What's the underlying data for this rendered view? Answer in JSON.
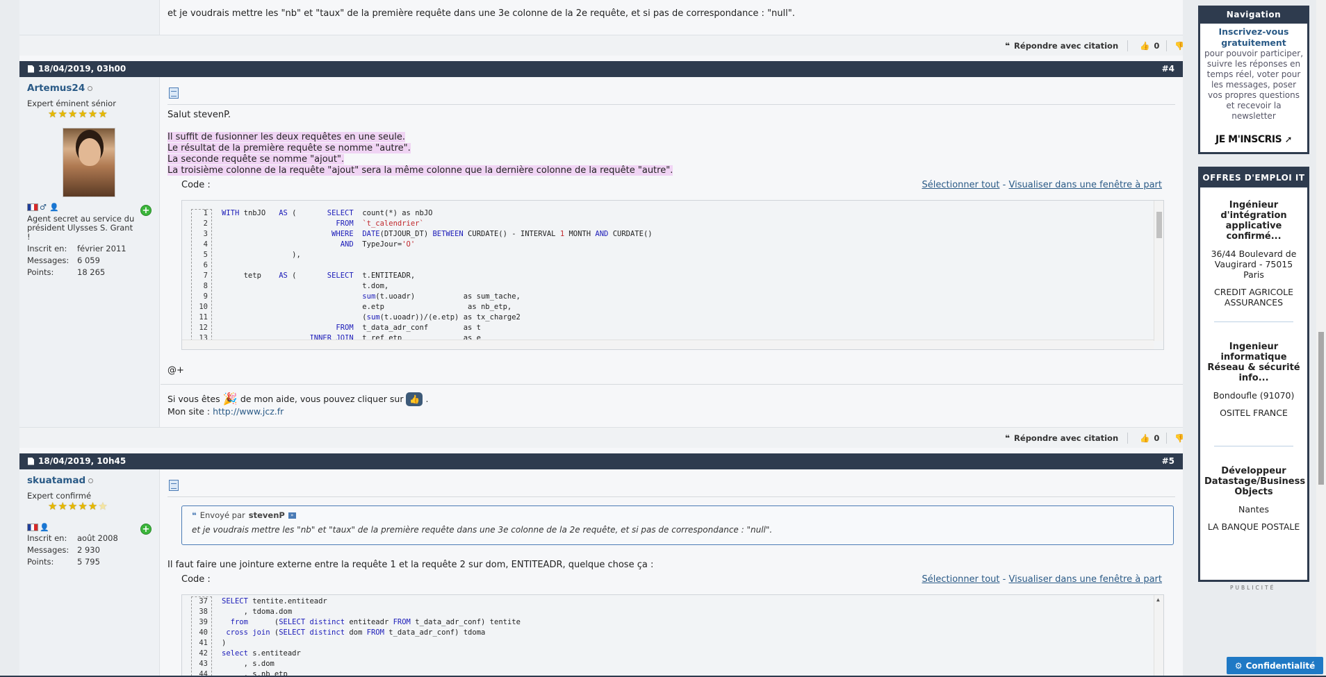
{
  "top_post": {
    "text": "et je voudrais mettre les \"nb\" et \"taux\" de la première requête dans une 3e colonne de la 2e requête, et si pas de correspondance : \"null\"."
  },
  "reply_bar": {
    "quote_label": "Répondre avec citation",
    "like_count": "0",
    "dislike_count": "0"
  },
  "post4": {
    "date": "18/04/2019, 03h00",
    "number": "#4",
    "user": {
      "name": "Artemus24",
      "rank": "Expert éminent sénior",
      "stars_on": "★★★★★★",
      "stars_off": "",
      "bio": "Agent secret au service du président Ulysses S. Grant !",
      "stats": [
        {
          "k": "Inscrit en:",
          "v": "février 2011"
        },
        {
          "k": "Messages:",
          "v": "6 059"
        },
        {
          "k": "Points:",
          "v": "18 265"
        }
      ]
    },
    "greeting": "Salut stevenP.",
    "lines": [
      "Il suffit de fusionner les deux requêtes en une seule.",
      "Le résultat de la première requête se nomme \"autre\".",
      "La seconde requête se nomme \"ajout\".",
      "La troisième colonne de la requête \"ajout\" sera la même colonne que la dernière colonne de la requête \"autre\"."
    ],
    "code_label": "Code :",
    "select_all": "Sélectionner tout",
    "dash": "-",
    "view_window": "Visualiser dans une fenêtre à part",
    "code": [
      {
        "n": "1",
        "html": "<span class=\"kw\">WITH</span> tnbJO   <span class=\"kw\">AS</span> (       <span class=\"kw\">SELECT</span>  count(*) as nbJO"
      },
      {
        "n": "2",
        "html": "                          <span class=\"kw\">FROM</span>  <span class=\"str\">`t_calendrier`</span>"
      },
      {
        "n": "3",
        "html": "                         <span class=\"kw\">WHERE</span>  <span class=\"kw\">DATE</span>(DTJOUR_DT) <span class=\"kw\">BETWEEN</span> CURDATE() - INTERVAL <span class=\"str\">1</span> MONTH <span class=\"kw\">AND</span> CURDATE()"
      },
      {
        "n": "4",
        "html": "                           <span class=\"kw\">AND</span>  TypeJour=<span class=\"str\">'O'</span>"
      },
      {
        "n": "5",
        "html": "                ),"
      },
      {
        "n": "6",
        "html": ""
      },
      {
        "n": "7",
        "html": "     tetp    <span class=\"kw\">AS</span> (       <span class=\"kw\">SELECT</span>  t.ENTITEADR,"
      },
      {
        "n": "8",
        "html": "                                t.dom,"
      },
      {
        "n": "9",
        "html": "                                <span class=\"kw\">sum</span>(t.uoadr)           as sum_tache,"
      },
      {
        "n": "10",
        "html": "                                e.etp                   as nb_etp,"
      },
      {
        "n": "11",
        "html": "                                (<span class=\"kw\">sum</span>(t.uoadr))/(e.etp) as tx_charge2"
      },
      {
        "n": "12",
        "html": "                          <span class=\"kw\">FROM</span>  t_data_adr_conf        as t"
      },
      {
        "n": "13",
        "html": "                    <span class=\"kw\">INNER JOIN</span>  t_ref_etp              as e"
      }
    ],
    "at_plus": "@+",
    "sig_pre": "Si vous êtes",
    "sig_mid": "de mon aide, vous pouvez cliquer sur",
    "sig_end": ".",
    "site_label": "Mon site :",
    "site_url": "http://www.jcz.fr"
  },
  "post5": {
    "date": "18/04/2019, 10h45",
    "number": "#5",
    "user": {
      "name": "skuatamad",
      "rank": "Expert confirmé",
      "stars_on": "★★★★★",
      "stars_off": "★",
      "stats": [
        {
          "k": "Inscrit en:",
          "v": "août 2008"
        },
        {
          "k": "Messages:",
          "v": "2 930"
        },
        {
          "k": "Points:",
          "v": "5 795"
        }
      ]
    },
    "quote_sent_by": "Envoyé par",
    "quote_author": "stevenP",
    "quote_text": "et je voudrais mettre les \"nb\" et \"taux\" de la première requête dans une 3e colonne de la 2e requête, et si pas de correspondance : \"null\".",
    "body": "Il faut faire une jointure externe entre la requête 1 et la requête 2 sur dom, ENTITEADR, quelque chose ça :",
    "code_label": "Code :",
    "select_all": "Sélectionner tout",
    "dash": "-",
    "view_window": "Visualiser dans une fenêtre à part",
    "code": [
      {
        "n": "37",
        "html": "<span class=\"kw\">SELECT</span> tentite.entiteadr"
      },
      {
        "n": "38",
        "html": "     , tdoma.dom"
      },
      {
        "n": "39",
        "html": "  <span class=\"kw\">from</span>      (<span class=\"kw\">SELECT distinct</span> entiteadr <span class=\"kw\">FROM</span> t_data_adr_conf) tentite"
      },
      {
        "n": "40",
        "html": " <span class=\"kw\">cross join</span> (<span class=\"kw\">SELECT distinct</span> dom <span class=\"kw\">FROM</span> t_data_adr_conf) tdoma"
      },
      {
        "n": "41",
        "html": ")"
      },
      {
        "n": "42",
        "html": "<span class=\"kw\">select</span> s.entiteadr"
      },
      {
        "n": "43",
        "html": "     , s.dom"
      },
      {
        "n": "44",
        "html": "     , s.nb_etp"
      }
    ]
  },
  "sidebar": {
    "nav_title": "Navigation",
    "nav_highlight": "Inscrivez-vous gratuitement",
    "nav_text": "pour pouvoir participer, suivre les réponses en temps réel, voter pour les messages, poser vos propres questions et recevoir la newsletter",
    "join_label": "JE M'INSCRIS",
    "jobs_title": "OFFRES D'EMPLOI IT",
    "jobs": [
      {
        "title": "Ingénieur d'intégration applicative confirmé...",
        "location": "36/44 Boulevard de Vaugirard - 75015 Paris",
        "company": "CREDIT AGRICOLE ASSURANCES"
      },
      {
        "title": "Ingenieur informatique Réseau & sécurité info...",
        "location": "Bondoufle (91070)",
        "company": "OSITEL FRANCE"
      },
      {
        "title": "Développeur Datastage/Business Objects",
        "location": "Nantes",
        "company": "LA BANQUE POSTALE"
      }
    ],
    "pub_label": "PUBLICITÉ"
  },
  "privacy_label": "Confidentialité"
}
